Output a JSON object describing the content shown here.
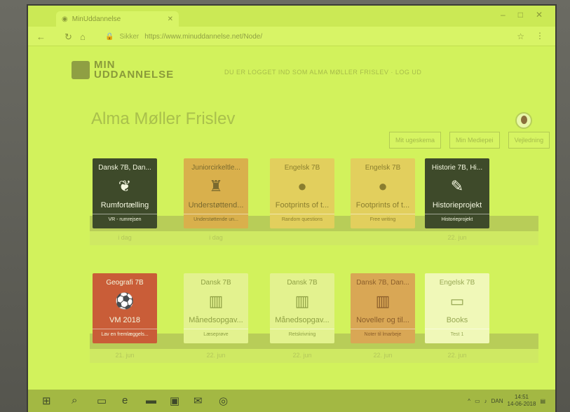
{
  "browser": {
    "tab_title": "MinUddannelse",
    "address_secure": "Sikker",
    "address_url": "https://www.minuddannelse.net/Node/"
  },
  "app": {
    "logo_line1": "MIN",
    "logo_line2": "UDDANNELSE",
    "login_notice": "DU ER LOGGET IND SOM ALMA MØLLER FRISLEV · LOG UD",
    "user_name": "Alma Møller Frislev",
    "buttons": [
      "Mit ugeskema",
      "Min Mediepei",
      "Vejledning"
    ]
  },
  "shelf1": [
    {
      "top": "Dansk 7B, Dan...",
      "icon": "rocket-icon",
      "glyph": "❦",
      "name": "Rumfortælling",
      "sub": "VR - rumrejsen",
      "style": "c-dark",
      "date": "i dag"
    },
    {
      "top": "Juniorcirkeltle...",
      "icon": "person-icon",
      "glyph": "♜",
      "name": "Understøttend...",
      "sub": "Understøttende un...",
      "style": "c-orange",
      "date": "i dag"
    },
    {
      "top": "Engelsk 7B",
      "icon": "globe-icon",
      "glyph": "●",
      "name": "Footprints of t...",
      "sub": "Random questions",
      "style": "c-orange2",
      "date": ""
    },
    {
      "top": "Engelsk 7B",
      "icon": "globe-icon",
      "glyph": "●",
      "name": "Footprints of t...",
      "sub": "Free writing",
      "style": "c-orange2",
      "date": ""
    },
    {
      "top": "Historie 7B, Hi...",
      "icon": "pencil-note-icon",
      "glyph": "✎",
      "name": "Historieprojekt",
      "sub": "Historieprojekt",
      "style": "c-dark",
      "date": "22. jun"
    }
  ],
  "shelf2": [
    {
      "top": "Geografi 7B",
      "icon": "football-icon",
      "glyph": "⚽",
      "name": "VM 2018",
      "sub": "Lav en fremlæggels...",
      "style": "c-red",
      "date": "21. jun"
    },
    {
      "top": "Dansk 7B",
      "icon": "books-icon",
      "glyph": "▥",
      "name": "Månedsopgav...",
      "sub": "Læseprøve",
      "style": "c-light",
      "date": "22. jun"
    },
    {
      "top": "Dansk 7B",
      "icon": "books-icon",
      "glyph": "▥",
      "name": "Månedsopgav...",
      "sub": "Retskrivning",
      "style": "c-light",
      "date": "22. jun"
    },
    {
      "top": "Dansk 7B, Dan...",
      "icon": "books-icon",
      "glyph": "▥",
      "name": "Noveller og til...",
      "sub": "Noter til lmarbeje",
      "style": "c-peach",
      "date": "22. jun"
    },
    {
      "top": "Engelsk 7B",
      "icon": "book-icon",
      "glyph": "▭",
      "name": "Books",
      "sub": "Test 1",
      "style": "c-pale",
      "date": "22. jun"
    }
  ],
  "taskbar": {
    "lang": "DAN",
    "time": "14:51",
    "date": "14-06-2018"
  }
}
